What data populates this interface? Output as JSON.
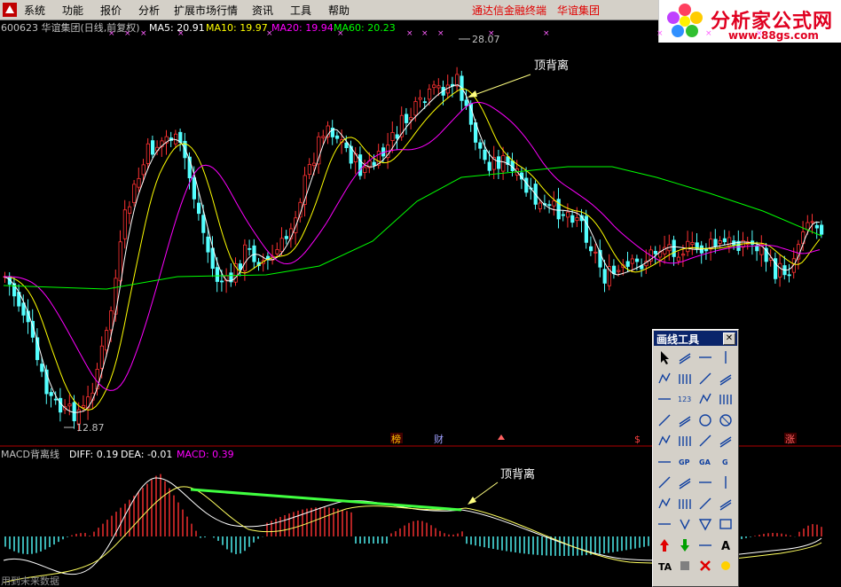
{
  "menu": {
    "items": [
      "系统",
      "功能",
      "报价",
      "分析",
      "扩展市场行情",
      "资讯",
      "工具",
      "帮助"
    ],
    "right_items": [
      "通达信金融终端",
      "华谊集团"
    ]
  },
  "brand": {
    "title": "分析家公式网",
    "url": "www.88gs.com"
  },
  "price_panel": {
    "header": {
      "code_name": "600623 华谊集团(日线,前复权)",
      "ma5": "MA5: 20.91",
      "ma10": "MA10: 19.97",
      "ma20": "MA20: 19.94",
      "ma60": "MA60: 20.23"
    },
    "high_label": "28.07",
    "low_label": "12.87",
    "annotation": "顶背离",
    "markers": [
      "榜",
      "财",
      "$",
      "涨"
    ]
  },
  "macd_panel": {
    "header": {
      "name": "MACD背离线",
      "diff": "DIFF: 0.19",
      "dea": "DEA: -0.01",
      "macd": "MACD: 0.39"
    },
    "annotation": "顶背离",
    "footer": "用到未来数据"
  },
  "toolbox": {
    "title": "画线工具"
  },
  "colors": {
    "up": "#ff3232",
    "down": "#54ffff",
    "ma5": "#ffffff",
    "ma10": "#ffff00",
    "ma20": "#ff00ff",
    "ma60": "#00ff00",
    "separator": "#b00000",
    "accent": "#ffff00"
  }
}
